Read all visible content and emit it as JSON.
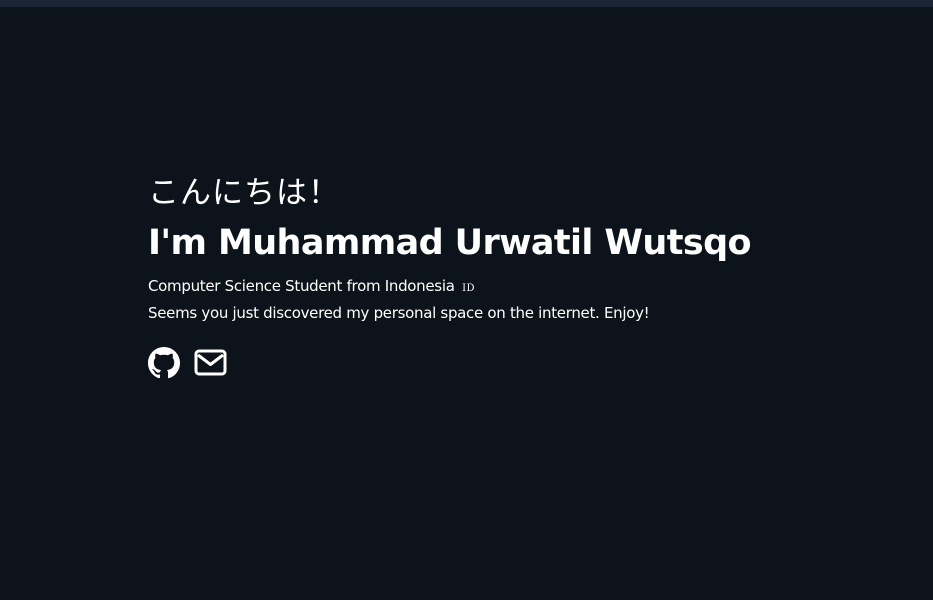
{
  "hero": {
    "greeting": "こんにちは！",
    "name": "I'm Muhammad Urwatil Wutsqo",
    "subtitle": "Computer Science Student from Indonesia",
    "flag": "ID",
    "tagline": "Seems you just discovered my personal space on the internet. Enjoy!"
  },
  "social": {
    "github_icon": "github-icon",
    "email_icon": "envelope-icon"
  },
  "colors": {
    "background": "#0d131a",
    "topbar": "#1a2432",
    "text": "#ffffff"
  }
}
